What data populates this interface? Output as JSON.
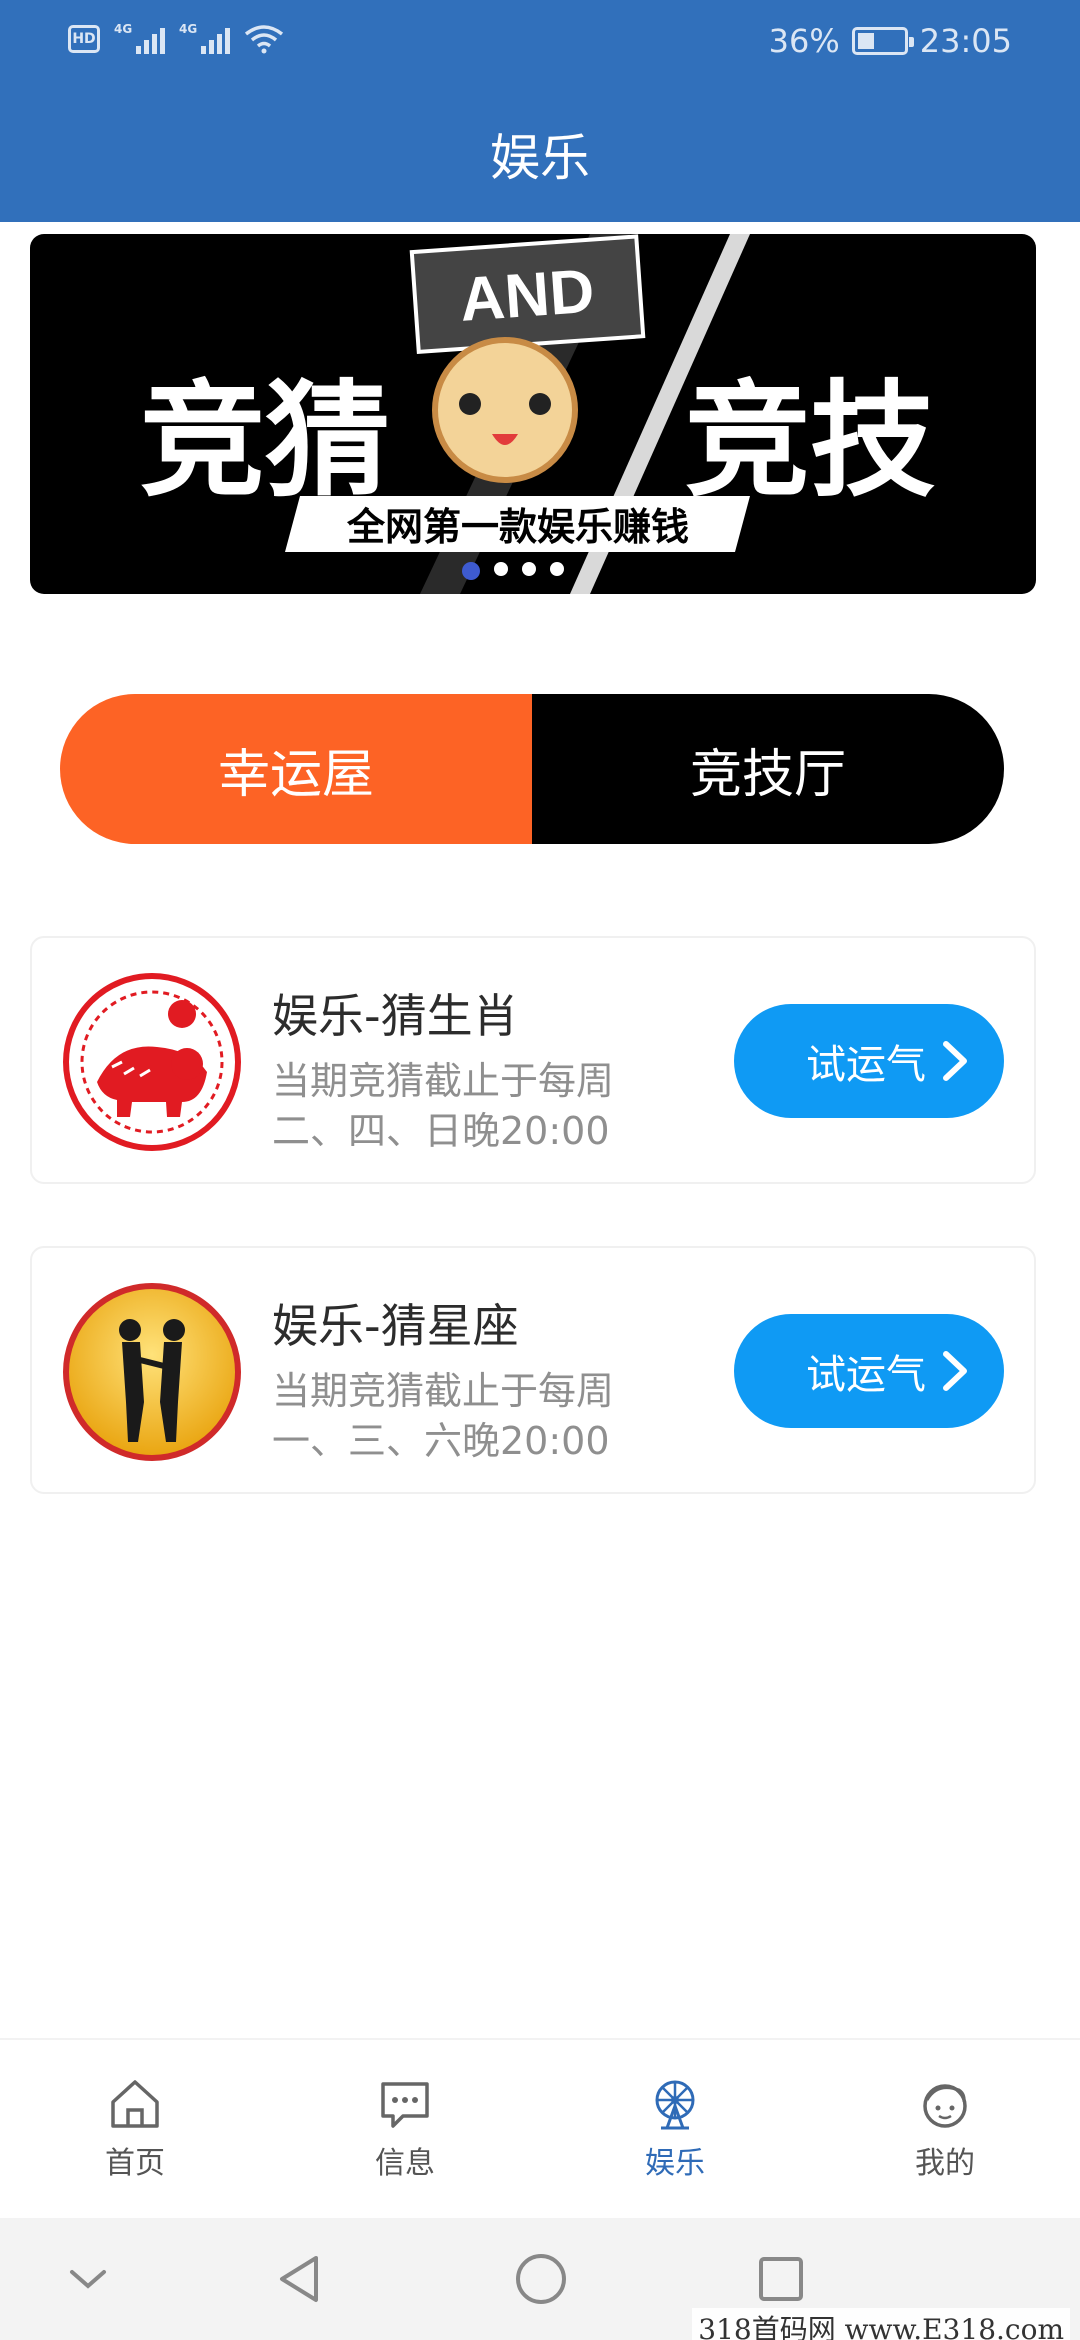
{
  "status_bar": {
    "hd": "HD",
    "net1": "4G",
    "net2": "4G",
    "battery_percent_label": "36%",
    "battery_level": 0.36,
    "time": "23:05"
  },
  "header": {
    "title": "娱乐"
  },
  "banner": {
    "text_left": "竞猜",
    "text_badge": "AND",
    "text_right": "竞技",
    "subtitle": "全网第一款娱乐赚钱",
    "slides": 4,
    "active_slide": 1
  },
  "tabs": [
    {
      "label": "幸运屋",
      "color": "#fd6325"
    },
    {
      "label": "竞技厅",
      "color": "#000000"
    }
  ],
  "games": [
    {
      "title": "娱乐-猜生肖",
      "desc_line1": "当期竞猜截止于每周",
      "desc_line2": "二、四、日晚20:00",
      "button": "试运气",
      "icon": "zodiac-tiger-icon"
    },
    {
      "title": "娱乐-猜星座",
      "desc_line1": "当期竞猜截止于每周",
      "desc_line2": "一、三、六晚20:00",
      "button": "试运气",
      "icon": "gemini-icon"
    }
  ],
  "bottom_nav": [
    {
      "label": "首页",
      "icon": "home-icon"
    },
    {
      "label": "信息",
      "icon": "message-icon"
    },
    {
      "label": "娱乐",
      "icon": "ferris-wheel-icon",
      "active": true
    },
    {
      "label": "我的",
      "icon": "profile-icon"
    }
  ],
  "watermark": "318首码网 www.E318.com",
  "colors": {
    "primary": "#3170bb",
    "accent_orange": "#fd6325",
    "button_blue": "#0f9af4"
  }
}
